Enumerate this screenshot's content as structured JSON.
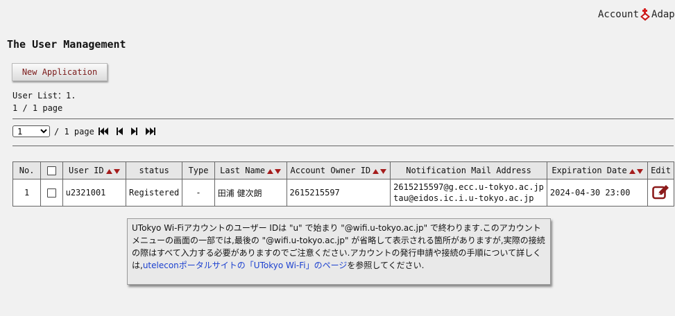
{
  "header": {
    "brand_text": "Account",
    "brand_text2": "Adapte"
  },
  "page": {
    "title": "The User Management"
  },
  "toolbar": {
    "new_application_label": "New Application"
  },
  "summary": {
    "user_list": "User List：1.",
    "page_info": "1 / 1 page"
  },
  "pager": {
    "selected_page": "1",
    "total_label": "/ 1 page"
  },
  "table": {
    "columns": {
      "no": "No.",
      "user_id": "User ID",
      "status": "status",
      "type": "Type",
      "last_name": "Last Name",
      "account_owner_id": "Account Owner ID",
      "notification_mail": "Notification Mail Address",
      "expiration_date": "Expiration Date",
      "edit": "Edit"
    },
    "rows": [
      {
        "no": "1",
        "user_id": "u2321001",
        "status": "Registered",
        "type": "-",
        "last_name": "田浦 健次朗",
        "account_owner_id": "2615215597",
        "mail1": "2615215597@g.ecc.u-tokyo.ac.jp",
        "mail2": "tau@eidos.ic.i.u-tokyo.ac.jp",
        "expiration_date": "2024-04-30 23:00"
      }
    ]
  },
  "notice": {
    "text_before": "UTokyo Wi-Fiアカウントのユーザー IDは \"u\" で始まり \"@wifi.u-tokyo.ac.jp\" で終わります.このアカウントメニューの画面の一部では,最後の \"@wifi.u-tokyo.ac.jp\" が省略して表示される箇所がありますが,実際の接続の際はすべて入力する必要がありますのでご注意ください.アカウントの発行申請や接続の手順について詳しくは,",
    "link_text": "uteleconポータルサイトの「UTokyo Wi-Fi」のページ",
    "text_after": "を参照してください."
  },
  "colors": {
    "sort_arrow": "#a51c1c",
    "link": "#1a3fcf",
    "edit_icon": "#8b1a1a",
    "button_text": "#7a1a1a"
  },
  "icons": [
    "adapter-logo-icon",
    "sort-icon",
    "first-page-icon",
    "prev-page-icon",
    "next-page-icon",
    "last-page-icon",
    "edit-icon"
  ]
}
